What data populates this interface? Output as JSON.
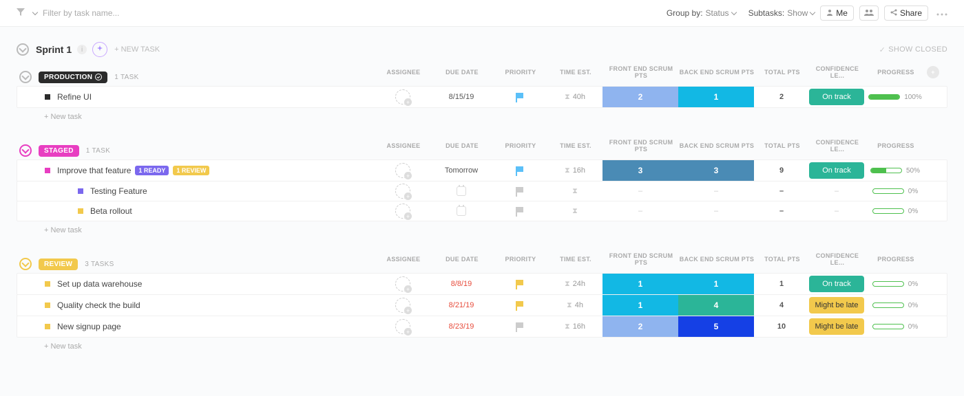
{
  "topbar": {
    "filter_placeholder": "Filter by task name...",
    "group_by_label": "Group by:",
    "group_by_value": "Status",
    "subtasks_label": "Subtasks:",
    "subtasks_value": "Show",
    "me_button": "Me",
    "share_button": "Share"
  },
  "sprint": {
    "title": "Sprint 1",
    "new_task": "+ NEW TASK",
    "show_closed": "SHOW CLOSED"
  },
  "columns": {
    "assignee": "ASSIGNEE",
    "due": "DUE DATE",
    "priority": "PRIORITY",
    "time": "TIME EST.",
    "fe": "FRONT END SCRUM PTS",
    "be": "BACK END SCRUM PTS",
    "total": "TOTAL PTS",
    "conf": "CONFIDENCE LE...",
    "prog": "PROGRESS"
  },
  "groups": [
    {
      "id": "production",
      "label": "PRODUCTION",
      "pill_icon": "check",
      "count": "1 TASK",
      "tasks": [
        {
          "square": "sq-black",
          "title": "Refine UI",
          "due": "8/15/19",
          "due_red": false,
          "flag": "blue",
          "time": "40h",
          "fe": {
            "val": "2",
            "bg": "bg-lblue"
          },
          "be": {
            "val": "1",
            "bg": "bg-cyan"
          },
          "total": "2",
          "conf": {
            "label": "On track",
            "cls": "conf-on"
          },
          "prog": {
            "pct": 100,
            "label": "100%"
          }
        }
      ],
      "new_task": "+ New task"
    },
    {
      "id": "staged",
      "label": "STAGED",
      "count": "1 TASK",
      "tasks": [
        {
          "square": "sq-pink",
          "title": "Improve that feature",
          "tags": [
            {
              "label": "1 READY",
              "cls": "ready"
            },
            {
              "label": "1 REVIEW",
              "cls": "review"
            }
          ],
          "due": "Tomorrow",
          "due_red": false,
          "flag": "blue",
          "time": "16h",
          "fe": {
            "val": "3",
            "bg": "bg-steel"
          },
          "be": {
            "val": "3",
            "bg": "bg-steel"
          },
          "total": "9",
          "conf": {
            "label": "On track",
            "cls": "conf-on"
          },
          "prog": {
            "pct": 50,
            "label": "50%"
          }
        },
        {
          "sub": true,
          "square": "sq-purple",
          "title": "Testing Feature",
          "due_empty": true,
          "flag": "grey",
          "time_empty": true,
          "fe": {
            "dash": true
          },
          "be": {
            "dash": true
          },
          "total": "–",
          "conf": {
            "dash": true
          },
          "prog": {
            "pct": 0,
            "label": "0%"
          }
        },
        {
          "sub": true,
          "square": "sq-yellow",
          "title": "Beta rollout",
          "due_empty": true,
          "flag": "grey",
          "time_empty": true,
          "fe": {
            "dash": true
          },
          "be": {
            "dash": true
          },
          "total": "–",
          "conf": {
            "dash": true
          },
          "prog": {
            "pct": 0,
            "label": "0%"
          }
        }
      ],
      "new_task": "+ New task"
    },
    {
      "id": "review",
      "label": "REVIEW",
      "count": "3 TASKS",
      "tasks": [
        {
          "square": "sq-yellow",
          "title": "Set up data warehouse",
          "due": "8/8/19",
          "due_red": true,
          "flag": "yellow",
          "time": "24h",
          "fe": {
            "val": "1",
            "bg": "bg-cyan"
          },
          "be": {
            "val": "1",
            "bg": "bg-cyan"
          },
          "total": "1",
          "conf": {
            "label": "On track",
            "cls": "conf-on"
          },
          "prog": {
            "pct": 0,
            "label": "0%"
          }
        },
        {
          "square": "sq-yellow",
          "title": "Quality check the build",
          "due": "8/21/19",
          "due_red": true,
          "flag": "yellow",
          "time": "4h",
          "fe": {
            "val": "1",
            "bg": "bg-cyan"
          },
          "be": {
            "val": "4",
            "bg": "bg-teal"
          },
          "total": "4",
          "conf": {
            "label": "Might be late",
            "cls": "conf-late"
          },
          "prog": {
            "pct": 0,
            "label": "0%"
          }
        },
        {
          "square": "sq-yellow",
          "title": "New signup page",
          "due": "8/23/19",
          "due_red": true,
          "flag": "grey",
          "time": "16h",
          "fe": {
            "val": "2",
            "bg": "bg-lblue2"
          },
          "be": {
            "val": "5",
            "bg": "bg-royal"
          },
          "total": "10",
          "conf": {
            "label": "Might be late",
            "cls": "conf-late"
          },
          "prog": {
            "pct": 0,
            "label": "0%"
          }
        }
      ],
      "new_task": "+ New task"
    }
  ]
}
